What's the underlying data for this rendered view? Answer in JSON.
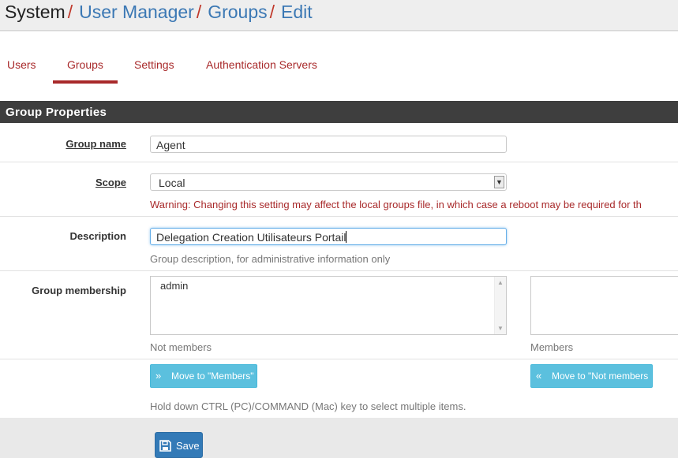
{
  "breadcrumb": {
    "root": "System",
    "items": [
      "User Manager",
      "Groups",
      "Edit"
    ],
    "separator": "/"
  },
  "tabs": [
    {
      "label": "Users",
      "active": false
    },
    {
      "label": "Groups",
      "active": true
    },
    {
      "label": "Settings",
      "active": false
    },
    {
      "label": "Authentication Servers",
      "active": false
    }
  ],
  "panel": {
    "title": "Group Properties"
  },
  "form": {
    "group_name": {
      "label": "Group name",
      "value": "Agent"
    },
    "scope": {
      "label": "Scope",
      "selected": "Local",
      "warning": "Warning: Changing this setting may affect the local groups file, in which case a reboot may be required for th"
    },
    "description": {
      "label": "Description",
      "value": "Delegation Creation Utilisateurs Portail",
      "help": "Group description, for administrative information only"
    },
    "membership": {
      "label": "Group membership",
      "not_members": [
        "admin"
      ],
      "not_members_label": "Not members",
      "members": [],
      "members_label": "Members",
      "move_to_members": "Move to \"Members\"",
      "move_to_not_members": "Move to \"Not members",
      "help": "Hold down CTRL (PC)/COMMAND (Mac) key to select multiple items."
    }
  },
  "save_label": "Save",
  "colors": {
    "accent": "#a8292a",
    "link": "#3b78b4",
    "panel_header": "#3e3e3e",
    "info_button": "#5bc0de",
    "primary_button": "#337ab7"
  }
}
